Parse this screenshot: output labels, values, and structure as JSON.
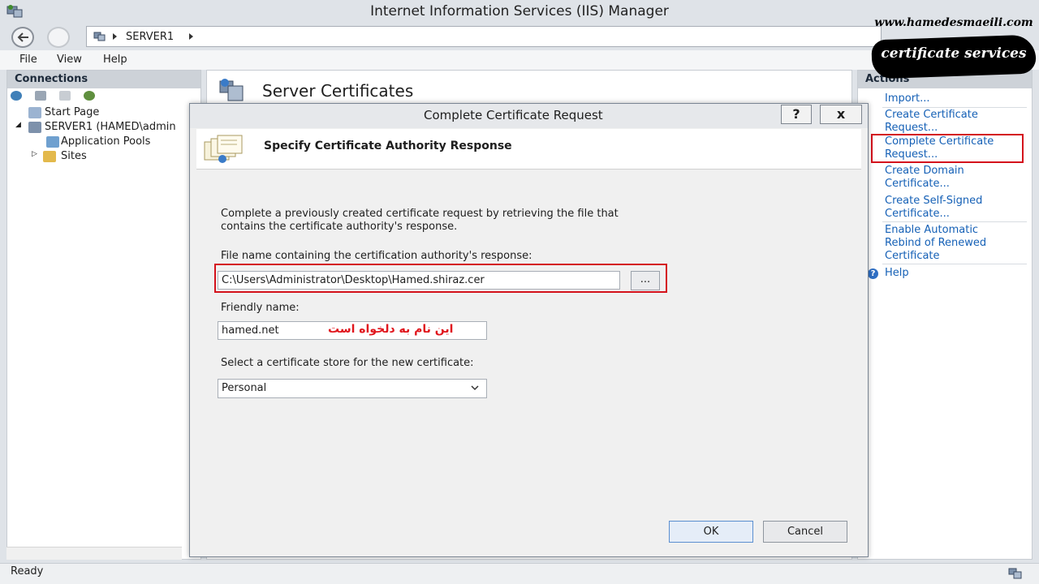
{
  "window": {
    "title": "Internet Information Services (IIS) Manager"
  },
  "address": {
    "crumb": "SERVER1"
  },
  "menu": [
    "File",
    "View",
    "Help"
  ],
  "connections": {
    "header": "Connections",
    "tree": [
      "Start Page",
      "SERVER1 (HAMED\\admin",
      "Application Pools",
      "Sites"
    ]
  },
  "center": {
    "heading": "Server Certificates"
  },
  "actions": {
    "header": "Actions",
    "items": [
      "Import...",
      "Create Certificate Request...",
      "Complete Certificate Request...",
      "Create Domain Certificate...",
      "Create Self-Signed Certificate...",
      "Enable Automatic Rebind of Renewed Certificate",
      "Help"
    ]
  },
  "status": {
    "text": "Ready"
  },
  "dialog": {
    "title": "Complete Certificate Request",
    "help_btn": "?",
    "close_btn": "x",
    "header": "Specify Certificate Authority Response",
    "intro": "Complete a previously created certificate request by retrieving the file that contains the certificate authority's response.",
    "file_label": "File name containing the certification authority's response:",
    "file_value": "C:\\Users\\Administrator\\Desktop\\Hamed.shiraz.cer",
    "browse_label": "...",
    "friendly_label": "Friendly name:",
    "friendly_value": "hamed.net",
    "friendly_note": "این نام به دلخواه است",
    "store_label": "Select a certificate store for the new certificate:",
    "store_value": "Personal",
    "ok_label": "OK",
    "cancel_label": "Cancel"
  },
  "watermark": {
    "site": "www.hamedesmaeili.com",
    "caption": "certificate services"
  },
  "colors": {
    "highlight": "#d4121c",
    "link": "#1560b6",
    "note": "#e0161d"
  }
}
